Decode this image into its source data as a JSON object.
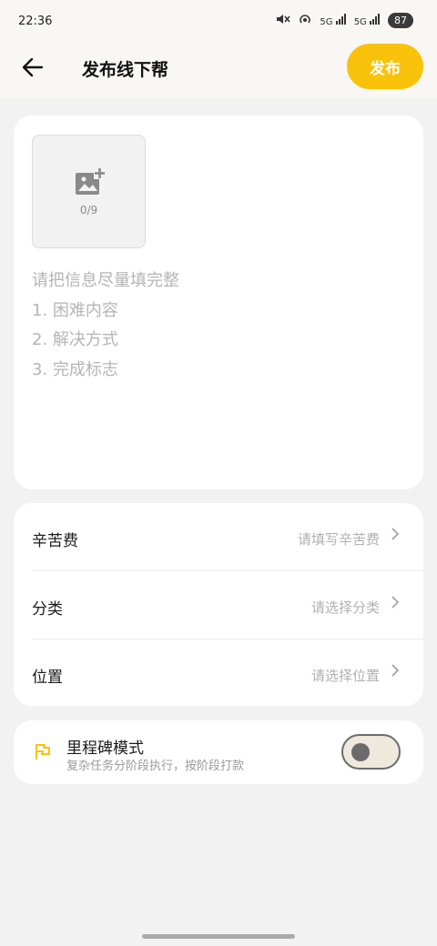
{
  "status_bar": {
    "time": "22:36",
    "signal_1": "5G",
    "signal_2": "5G",
    "battery": "87"
  },
  "header": {
    "title": "发布线下帮",
    "publish_label": "发布"
  },
  "upload": {
    "count": "0/9"
  },
  "hints": [
    "请把信息尽量填完整",
    "1. 困难内容",
    "2. 解决方式",
    "3. 完成标志"
  ],
  "fields": [
    {
      "label": "辛苦费",
      "placeholder": "请填写辛苦费"
    },
    {
      "label": "分类",
      "placeholder": "请选择分类"
    },
    {
      "label": "位置",
      "placeholder": "请选择位置"
    }
  ],
  "milestone": {
    "title": "里程碑模式",
    "subtitle": "复杂任务分阶段执行，按阶段打款",
    "enabled": false
  },
  "colors": {
    "accent": "#f9c20a",
    "background": "#f2f2f2",
    "card": "#ffffff",
    "hint_text": "#b5b5b5"
  },
  "icons": {
    "back": "arrow-left",
    "upload": "add-photo",
    "chevron": "chevron-right",
    "milestone": "flag"
  }
}
